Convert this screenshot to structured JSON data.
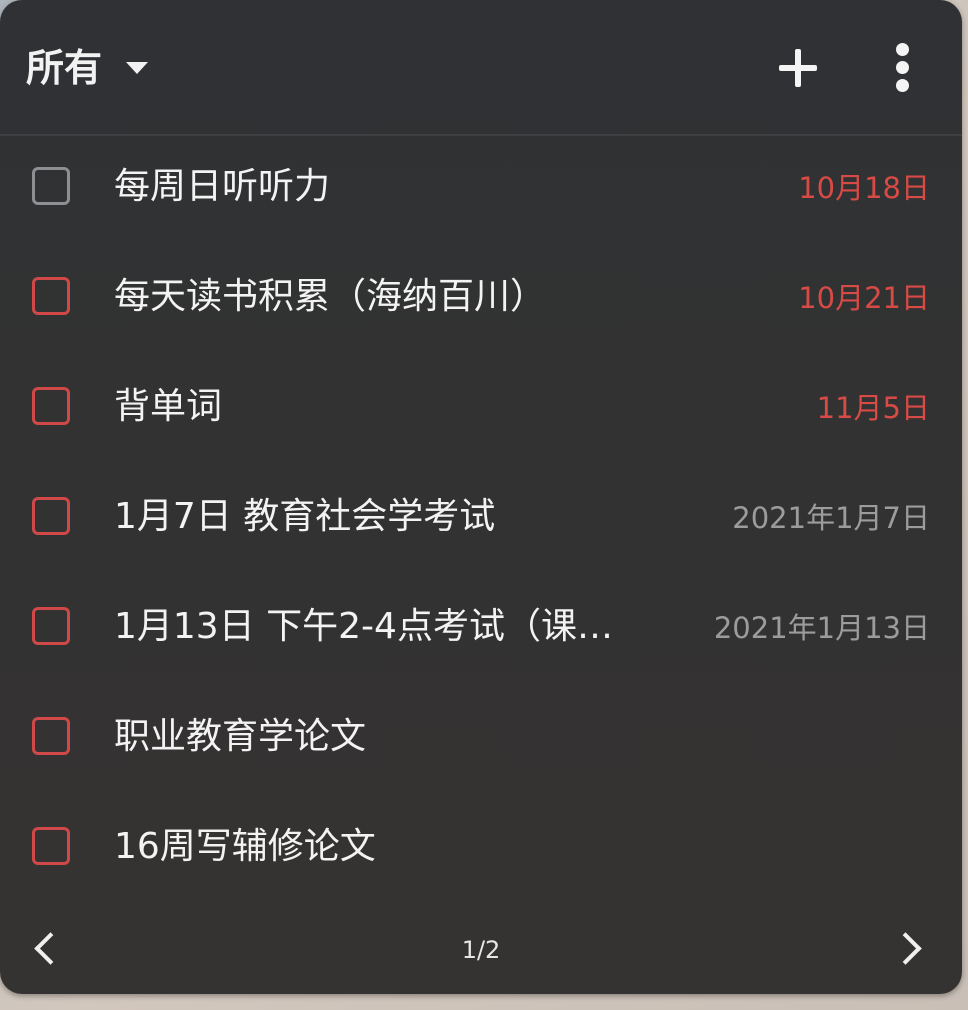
{
  "header": {
    "filter_label": "所有",
    "add_icon": "plus-icon",
    "more_icon": "more-vertical-icon"
  },
  "colors": {
    "overdue": "#d84a45",
    "normal_date": "#9c9c9c",
    "checkbox_red": "#d04848",
    "checkbox_grey": "#8d8f92"
  },
  "tasks": [
    {
      "title": "每周日听听力",
      "date": "10月18日",
      "overdue": true,
      "checkbox": "grey"
    },
    {
      "title": "每天读书积累（海纳百川）",
      "date": "10月21日",
      "overdue": true,
      "checkbox": "red"
    },
    {
      "title": "背单词",
      "date": "11月5日",
      "overdue": true,
      "checkbox": "red"
    },
    {
      "title": "1月7日 教育社会学考试",
      "date": "2021年1月7日",
      "overdue": false,
      "checkbox": "red"
    },
    {
      "title": "1月13日 下午2-4点考试（课…",
      "date": "2021年1月13日",
      "overdue": false,
      "checkbox": "red"
    },
    {
      "title": "职业教育学论文",
      "date": "",
      "overdue": false,
      "checkbox": "red"
    },
    {
      "title": "16周写辅修论文",
      "date": "",
      "overdue": false,
      "checkbox": "red"
    }
  ],
  "footer": {
    "page_indicator": "1/2",
    "prev_icon": "chevron-left-icon",
    "next_icon": "chevron-right-icon"
  }
}
